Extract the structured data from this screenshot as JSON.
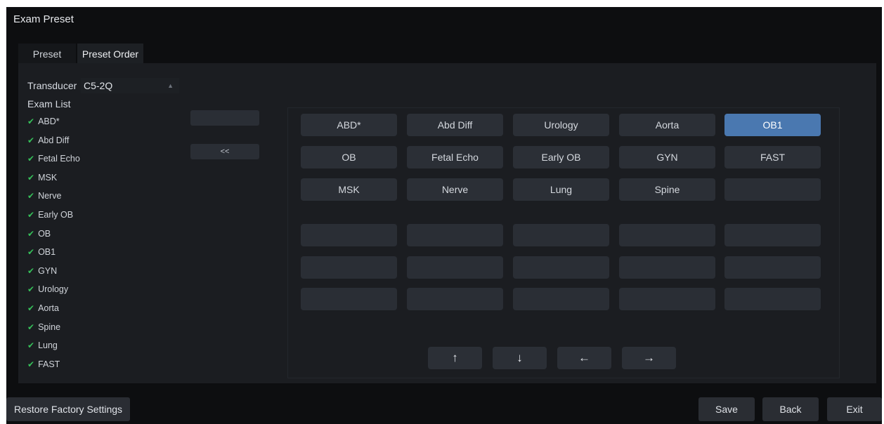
{
  "window": {
    "title": "Exam Preset"
  },
  "tabs": [
    {
      "label": "Preset",
      "active": false
    },
    {
      "label": "Preset Order",
      "active": true
    }
  ],
  "transducer": {
    "label": "Transducer",
    "value": "C5-2Q"
  },
  "exam_list": {
    "label": "Exam List",
    "items": [
      "ABD*",
      "Abd Diff",
      "Fetal Echo",
      "MSK",
      "Nerve",
      "Early OB",
      "OB",
      "OB1",
      "GYN",
      "Urology",
      "Aorta",
      "Spine",
      "Lung",
      "FAST"
    ]
  },
  "side_buttons": {
    "add_label": "",
    "remove_label": "<<"
  },
  "grid": {
    "rows": [
      [
        "ABD*",
        "Abd Diff",
        "Urology",
        "Aorta",
        "OB1"
      ],
      [
        "OB",
        "Fetal Echo",
        "Early OB",
        "GYN",
        "FAST"
      ],
      [
        "MSK",
        "Nerve",
        "Lung",
        "Spine",
        ""
      ],
      [
        "",
        "",
        "",
        "",
        ""
      ],
      [
        "",
        "",
        "",
        "",
        ""
      ],
      [
        "",
        "",
        "",
        "",
        ""
      ]
    ],
    "selected": "OB1"
  },
  "arrows": {
    "up": "↑",
    "down": "↓",
    "left": "←",
    "right": "→"
  },
  "footer": {
    "restore_label": "Restore Factory Settings",
    "save_label": "Save",
    "back_label": "Back",
    "exit_label": "Exit"
  },
  "colors": {
    "selected": "#4a78b0",
    "check": "#36c05a",
    "background": "#0d0e10"
  }
}
